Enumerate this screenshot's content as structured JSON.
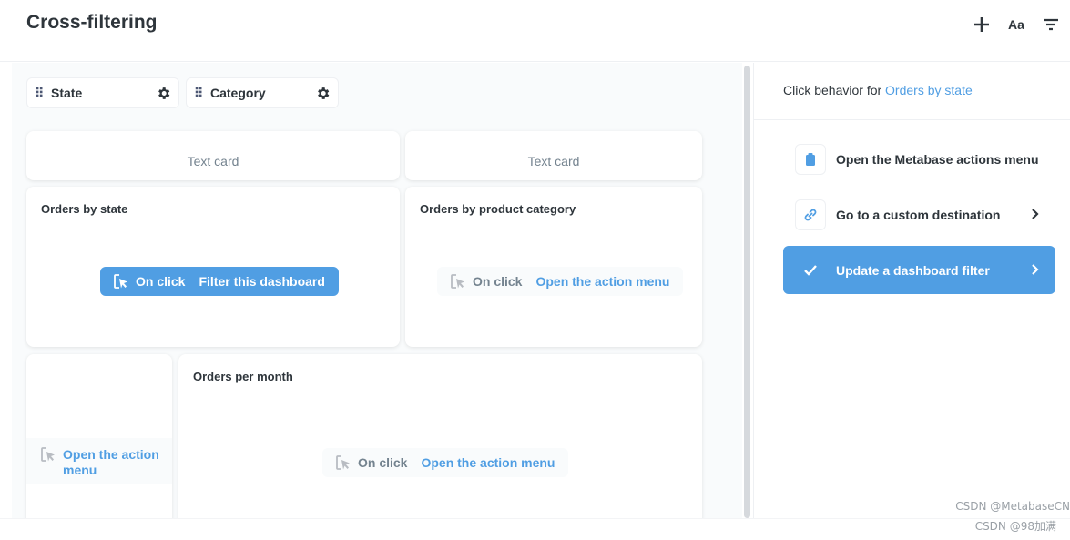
{
  "header": {
    "title": "Cross-filtering",
    "icons": [
      "plus-icon",
      "font-icon",
      "filter-icon"
    ],
    "font_label": "Aa"
  },
  "filters": [
    {
      "label": "State",
      "icon": "grip-icon"
    },
    {
      "label": "Category",
      "icon": "grip-icon"
    }
  ],
  "cards": {
    "text_card_1": "Text card",
    "text_card_2": "Text card",
    "orders_by_state": {
      "title": "Orders by state",
      "on_click": "On click",
      "action": "Filter this dashboard"
    },
    "orders_by_category": {
      "title": "Orders by product category",
      "on_click": "On click",
      "action": "Open the action menu"
    },
    "small_card": {
      "action_line1": "Open the action",
      "action_line2": "menu"
    },
    "orders_per_month": {
      "title": "Orders per month",
      "on_click": "On click",
      "action": "Open the action menu"
    }
  },
  "side_panel": {
    "title_prefix": "Click behavior for",
    "title_link": "Orders by state",
    "options": [
      {
        "label": "Open the Metabase actions menu",
        "icon": "clipboard-icon"
      },
      {
        "label": "Go to a custom destination",
        "icon": "link-icon"
      },
      {
        "label": "Update a dashboard filter",
        "icon": "check-icon"
      }
    ]
  },
  "watermark": {
    "line1": "CSDN @MetabaseCN",
    "line2": "CSDN @98加满"
  },
  "colors": {
    "brand": "#509ee3",
    "text_dark": "#2e353b",
    "text_medium": "#74838f"
  }
}
